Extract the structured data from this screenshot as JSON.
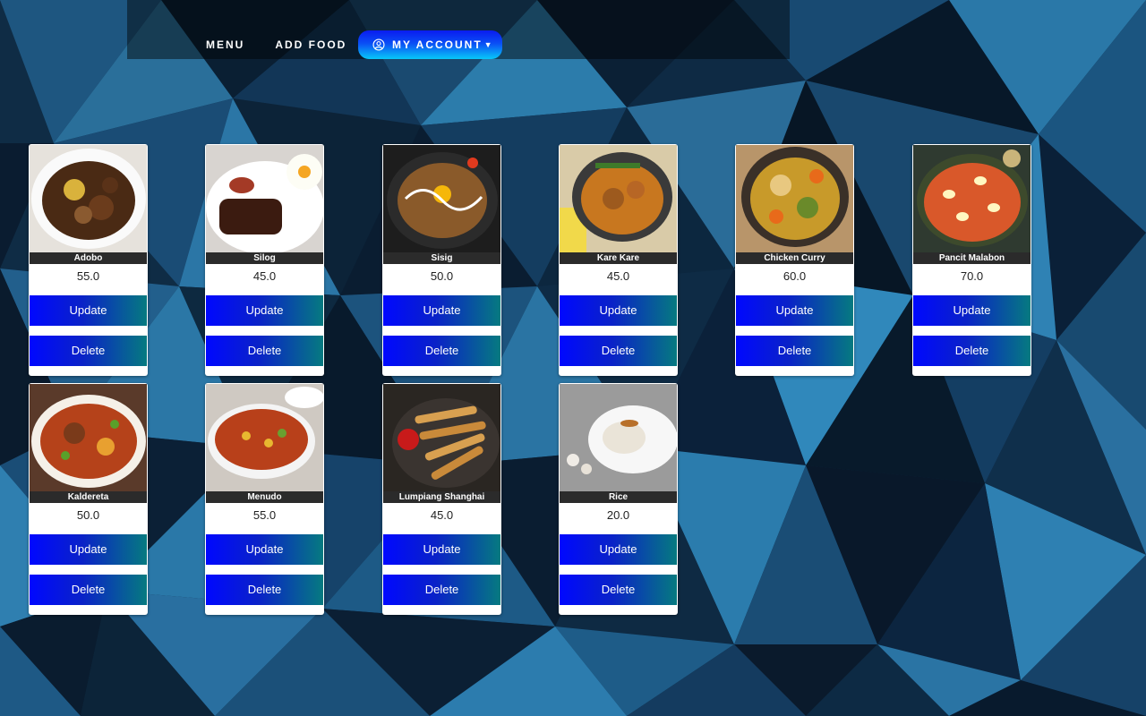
{
  "nav": {
    "menu_label": "MENU",
    "add_food_label": "ADD FOOD",
    "account_label": "MY ACCOUNT"
  },
  "colors": {
    "background": "#0f2c45",
    "button_gradient_start": "#0008ff",
    "button_gradient_end": "#067a80",
    "account_button_top": "#0a1cf0",
    "account_button_bottom": "#08c8f8"
  },
  "foods": [
    {
      "name": "Adobo",
      "price": "55.0",
      "update_label": "Update",
      "delete_label": "Delete"
    },
    {
      "name": "Silog",
      "price": "45.0",
      "update_label": "Update",
      "delete_label": "Delete"
    },
    {
      "name": "Sisig",
      "price": "50.0",
      "update_label": "Update",
      "delete_label": "Delete"
    },
    {
      "name": "Kare Kare",
      "price": "45.0",
      "update_label": "Update",
      "delete_label": "Delete"
    },
    {
      "name": "Chicken Curry",
      "price": "60.0",
      "update_label": "Update",
      "delete_label": "Delete"
    },
    {
      "name": "Pancit Malabon",
      "price": "70.0",
      "update_label": "Update",
      "delete_label": "Delete"
    },
    {
      "name": "Kaldereta",
      "price": "50.0",
      "update_label": "Update",
      "delete_label": "Delete"
    },
    {
      "name": "Menudo",
      "price": "55.0",
      "update_label": "Update",
      "delete_label": "Delete"
    },
    {
      "name": "Lumpiang Shanghai",
      "price": "45.0",
      "update_label": "Update",
      "delete_label": "Delete"
    },
    {
      "name": "Rice",
      "price": "20.0",
      "update_label": "Update",
      "delete_label": "Delete"
    }
  ]
}
